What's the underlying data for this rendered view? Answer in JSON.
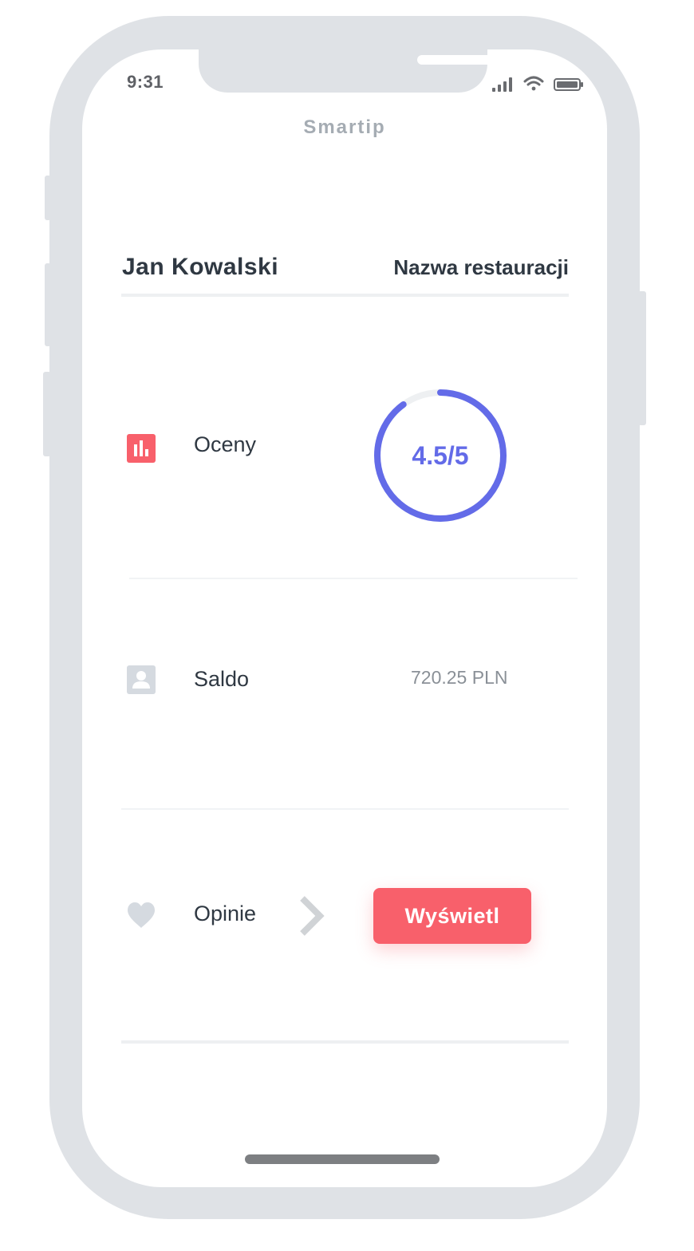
{
  "status_bar": {
    "time": "9:31"
  },
  "app": {
    "title": "Smartip"
  },
  "header": {
    "user_name": "Jan Kowalski",
    "restaurant_name": "Nazwa restauracji"
  },
  "rows": [
    {
      "label": "Oceny",
      "icon": "bar-chart-icon",
      "value": "4.5/5",
      "rating": 4.5,
      "rating_max": 5
    },
    {
      "label": "Saldo",
      "icon": "user-icon",
      "value": "720.25 PLN"
    },
    {
      "label": "Opinie",
      "icon": "heart-icon",
      "action_label": "Wyświetl"
    }
  ],
  "colors": {
    "accent": "#f8606b",
    "gauge": "#636be8",
    "gauge_track": "#eef0f2",
    "text_dark": "#2f3842",
    "text_muted": "#8a9097",
    "icon_muted": "#d5dae0",
    "frame": "#dfe2e6"
  }
}
